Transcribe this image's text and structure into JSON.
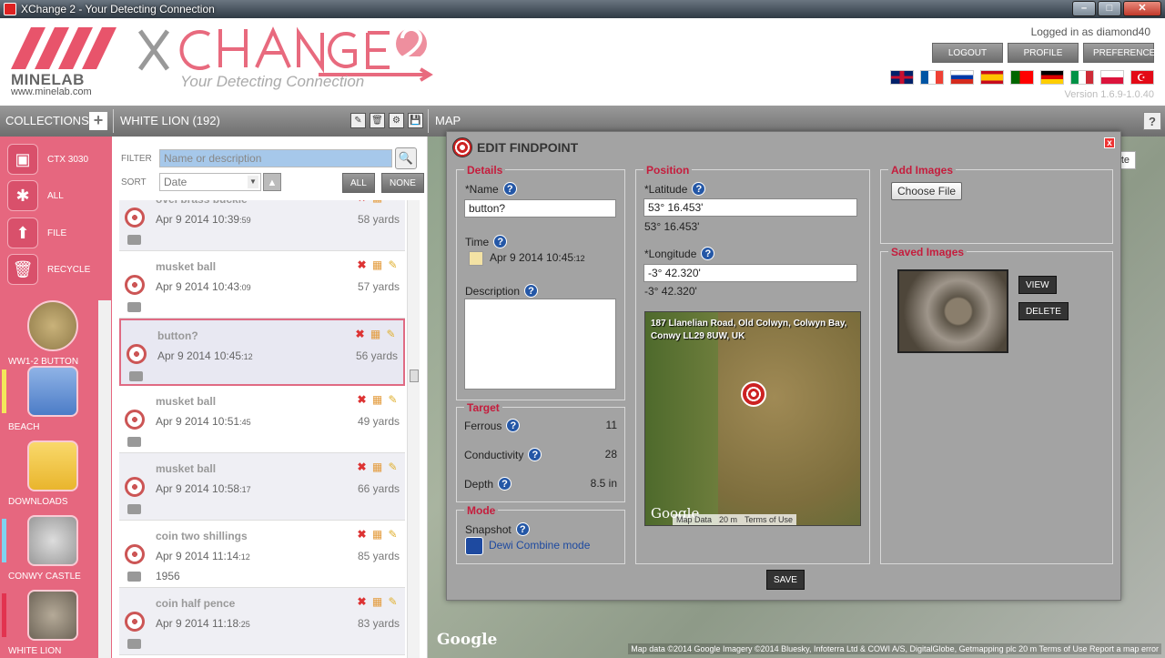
{
  "window": {
    "title": "XChange 2 - Your Detecting Connection",
    "controls": [
      "–",
      "□",
      "✕"
    ]
  },
  "header": {
    "logo_text": "MINELAB",
    "logo_url": "www.minelab.com",
    "tagline": "Your Detecting Connection",
    "logged_in": "Logged in as diamond40",
    "buttons": {
      "logout": "LOGOUT",
      "profile": "PROFILE",
      "preferences": "PREFERENCES"
    },
    "version": "Version 1.6.9-1.0.40",
    "flags": [
      "#c8102e",
      "#0055a4",
      "#d52b1e",
      "#f1bf00",
      "#006600",
      "#000000",
      "#009246",
      "#dc143c",
      "#e30a17"
    ]
  },
  "toolbar": {
    "collections": "COLLECTIONS",
    "current_collection": "WHITE LION (192)",
    "map": "MAP",
    "help": "?"
  },
  "sidebar": {
    "top_items": [
      {
        "label": "CTX 3030",
        "icon": "detector-icon"
      },
      {
        "label": "ALL",
        "icon": "all-icon"
      },
      {
        "label": "FILE",
        "icon": "file-icon"
      },
      {
        "label": "RECYCLE",
        "icon": "recycle-icon"
      }
    ],
    "collections": [
      {
        "label": "WW1-2 BUTTON",
        "bar": ""
      },
      {
        "label": "BEACH",
        "bar": "#f3e75a"
      },
      {
        "label": "DOWNLOADS",
        "bar": ""
      },
      {
        "label": "CONWY CASTLE",
        "bar": "#7fd3f0"
      },
      {
        "label": "WHITE LION",
        "bar": "#e2334f"
      }
    ]
  },
  "list": {
    "filter_label": "FILTER",
    "filter_placeholder": "Name or description",
    "sort_label": "SORT",
    "sort_value": "Date",
    "all": "ALL",
    "none": "NONE",
    "rows": [
      {
        "name": "ovel brass buckle",
        "date": "Apr 9 2014 10:39",
        "sec": ":59",
        "dist": "58 yards",
        "note": ""
      },
      {
        "name": "musket ball",
        "date": "Apr 9 2014 10:43",
        "sec": ":09",
        "dist": "57 yards",
        "note": ""
      },
      {
        "name": "button?",
        "date": "Apr 9 2014 10:45",
        "sec": ":12",
        "dist": "56 yards",
        "note": ""
      },
      {
        "name": "musket ball",
        "date": "Apr 9 2014 10:51",
        "sec": ":45",
        "dist": "49 yards",
        "note": ""
      },
      {
        "name": "musket ball",
        "date": "Apr 9 2014 10:58",
        "sec": ":17",
        "dist": "66 yards",
        "note": ""
      },
      {
        "name": "coin two shillings",
        "date": "Apr 9 2014 11:14",
        "sec": ":12",
        "dist": "85 yards",
        "note": "1956"
      },
      {
        "name": "coin half pence",
        "date": "Apr 9 2014 11:18",
        "sec": ":25",
        "dist": "83 yards",
        "note": ""
      }
    ]
  },
  "map": {
    "satellite": "atellite",
    "google": "Google",
    "attribution": "Map data ©2014 Google Imagery ©2014 Bluesky, Infoterra Ltd & COWI A/S, DigitalGlobe, Getmapping plc   20 m   Terms of Use   Report a map error"
  },
  "dialog": {
    "title": "EDIT FINDPOINT",
    "close": "x",
    "details": {
      "title": "Details",
      "name_label": "*Name",
      "name_value": "button?",
      "time_label": "Time",
      "time_value": "Apr 9 2014 10:45",
      "time_sec": ":12",
      "description_label": "Description"
    },
    "target": {
      "title": "Target",
      "ferrous_label": "Ferrous",
      "ferrous_value": "11",
      "conductivity_label": "Conductivity",
      "conductivity_value": "28",
      "depth_label": "Depth",
      "depth_value": "8.5 in"
    },
    "mode": {
      "title": "Mode",
      "snapshot_label": "Snapshot",
      "snapshot_value": "Dewi Combine mode"
    },
    "position": {
      "title": "Position",
      "latitude_label": "*Latitude",
      "latitude_input": "53° 16.453'",
      "latitude_text": "53° 16.453'",
      "longitude_label": "*Longitude",
      "longitude_input": "-3° 42.320'",
      "longitude_text": "-3° 42.320'",
      "address": "187 Llanelian Road, Old Colwyn, Colwyn Bay, Conwy LL29 8UW, UK",
      "map_google": "Google",
      "map_data": "Map Data",
      "map_scale": "20 m",
      "map_terms": "Terms of Use"
    },
    "add_images": {
      "title": "Add Images",
      "choose_file": "Choose File"
    },
    "saved_images": {
      "title": "Saved Images",
      "view": "VIEW",
      "delete": "DELETE"
    },
    "save": "SAVE"
  }
}
